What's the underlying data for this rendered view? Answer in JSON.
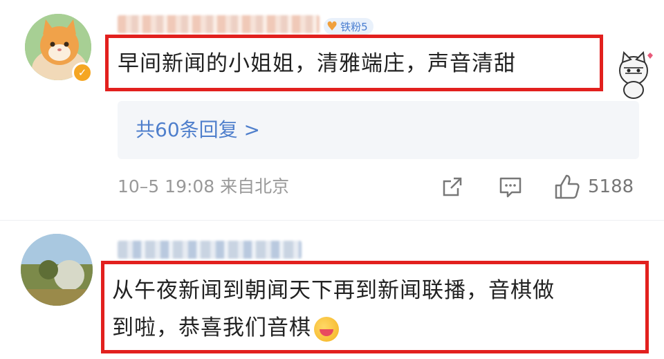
{
  "comment1": {
    "fan_badge": "铁粉5",
    "text": "早间新闻的小姐姐，清雅端庄，声音清甜",
    "replies_link": "共60条回复 >",
    "meta": "10–5 19:08 来自北京",
    "like_count": "5188"
  },
  "comment2": {
    "text_line1": "从午夜新闻到朝闻天下再到新闻联播，音棋做",
    "text_line2": "到啦，恭喜我们音棋"
  },
  "colors": {
    "highlight": "#e2201e",
    "link": "#4f7fcc",
    "meta": "#999999"
  }
}
